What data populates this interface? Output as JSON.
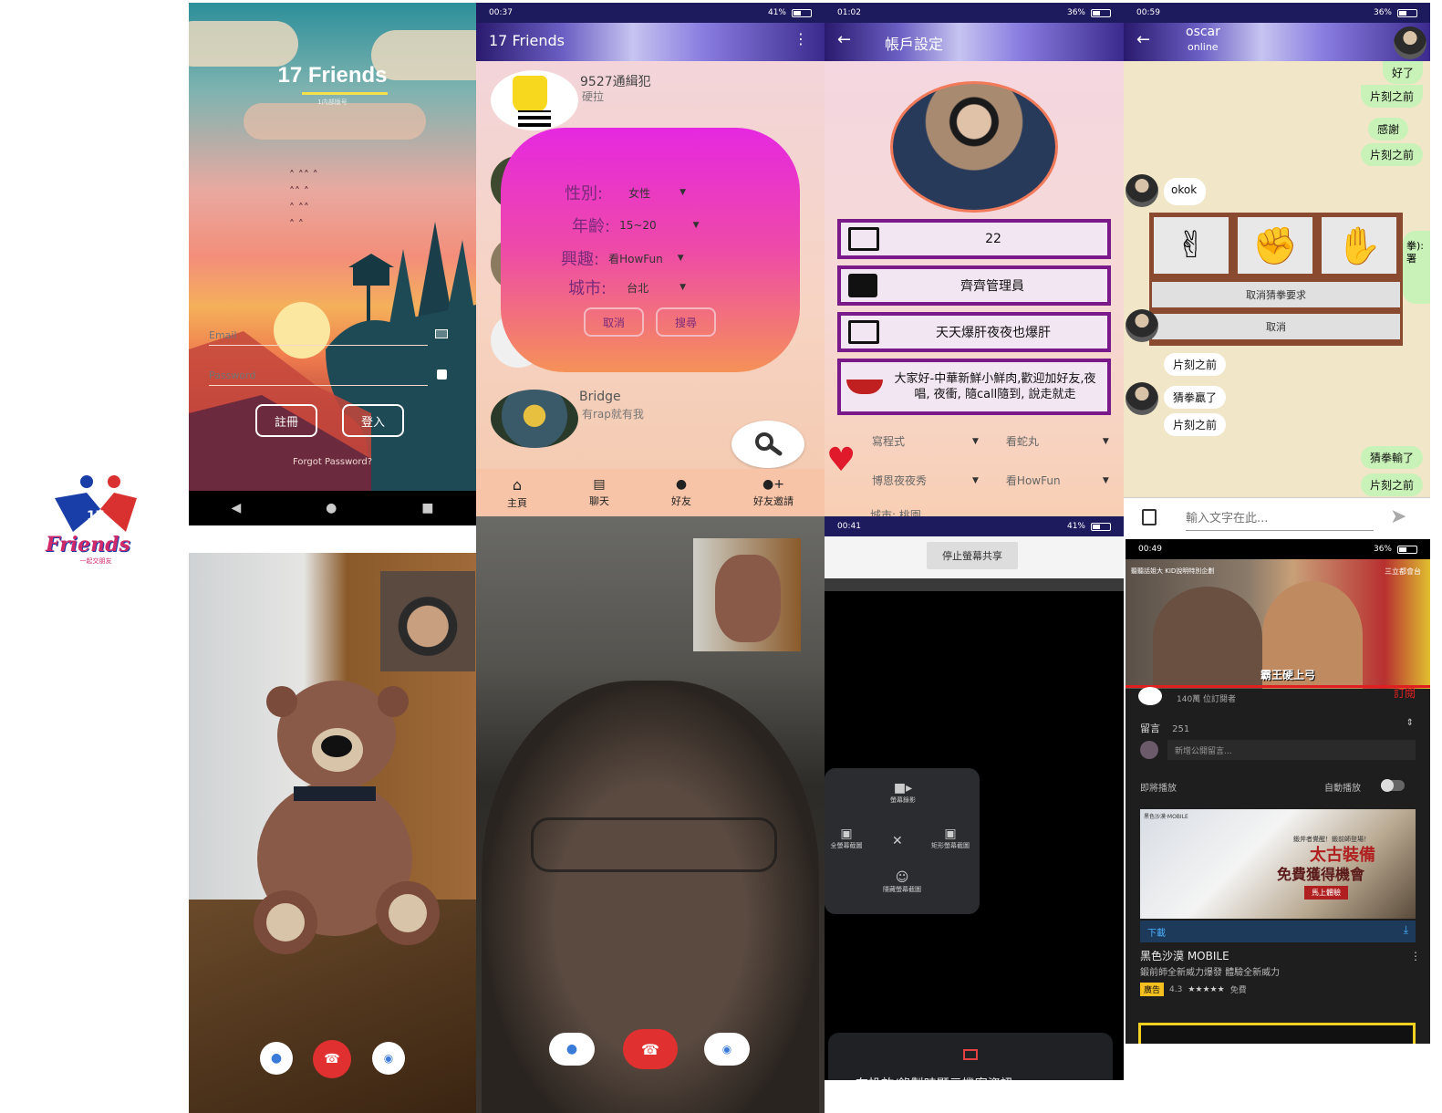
{
  "logo": {
    "number": "17",
    "word": "Friends",
    "tagline": "一起交朋友"
  },
  "login": {
    "title": "17 Friends",
    "subtitle": "1内部版号",
    "email_placeholder": "Email",
    "password_placeholder": "Password",
    "register_label": "註冊",
    "login_label": "登入",
    "forgot": "Forgot Password?"
  },
  "home": {
    "status_time": "00:37",
    "status_battery": "41%",
    "app_title": "17 Friends",
    "first_user": {
      "name": "9527通緝犯",
      "status": "硬拉"
    },
    "bridge_user": {
      "name": "Bridge",
      "status": "有rap就有我"
    },
    "dialog": {
      "gender_label": "性別:",
      "gender_value": "女性",
      "age_label": "年齡:",
      "age_value": "15~20",
      "interest_label": "興趣:",
      "interest_value": "看HowFun",
      "city_label": "城市:",
      "city_value": "台北",
      "cancel": "取消",
      "search": "搜尋"
    },
    "tabs": [
      "主頁",
      "聊天",
      "好友",
      "好友邀請"
    ]
  },
  "account": {
    "status_time": "01:02",
    "status_battery": "36%",
    "title": "帳戶設定",
    "age": "22",
    "name": "齊齊管理員",
    "motto": "天天爆肝夜夜也爆肝",
    "intro": "大家好-中華新鮮小鮮肉,歡迎加好友,夜唱, 夜衝, 隨call隨到, 說走就走",
    "interest1": "寫程式",
    "interest2": "看蛇丸",
    "interest3": "博恩夜夜秀",
    "interest4": "看HowFun",
    "city_partial": "城市: 桃園"
  },
  "chat": {
    "status_time": "00:59",
    "status_battery": "36%",
    "contact_name": "oscar",
    "contact_status": "online",
    "messages_right": [
      {
        "text": "好了"
      },
      {
        "text": "片刻之前"
      },
      {
        "text": "感謝"
      },
      {
        "text": "片刻之前"
      }
    ],
    "okok": "okok",
    "cancel_rps_request": "取消猜拳要求",
    "cancel": "取消",
    "edge_text_1": "拳):",
    "edge_text_2": "署",
    "msg_time_1": "片刻之前",
    "guess_win": "猜拳贏了",
    "msg_time_2": "片刻之前",
    "guess_lose": "猜拳輸了",
    "msg_time_3": "片刻之前",
    "input_placeholder": "輸入文字在此..."
  },
  "screenshare": {
    "status_time": "00:41",
    "status_battery": "41%",
    "stop_share": "停止螢幕共享",
    "opt_record": "螢幕錄影",
    "opt_full": "全螢幕截圖",
    "opt_region": "矩形螢幕截圖",
    "opt_hide": "隱藏螢幕截圖",
    "bottom_text": "在投放/錄製時顯示機密資訊"
  },
  "youtube": {
    "status_time": "00:49",
    "status_battery": "36%",
    "video_tag_left": "聽聽話姐大 KID說明特別企劃",
    "video_tag_right": "三立都會台",
    "caption": "霸王硬上弓",
    "subscribers": "140萬 位訂閱者",
    "subscribe": "訂閱",
    "comments_label": "留言",
    "comments_count": "251",
    "comment_placeholder": "新增公開留言...",
    "up_next": "即將播放",
    "autoplay": "自動播放",
    "ad_title_1": "太古裝備",
    "ad_title_2": "免費獲得機會",
    "ad_game_badge": "黑色沙漠·MOBILE",
    "ad_small_top": "鍛斧者覺醒！鍛前師登場！",
    "ad_cta": "馬上體驗",
    "download": "下載",
    "app_name": "黑色沙漠 MOBILE",
    "app_desc": "鍛前師全新威力爆發 體驗全新威力",
    "ad_badge": "廣告",
    "rating": "4.3",
    "stars": "★★★★★",
    "price": "免費"
  }
}
